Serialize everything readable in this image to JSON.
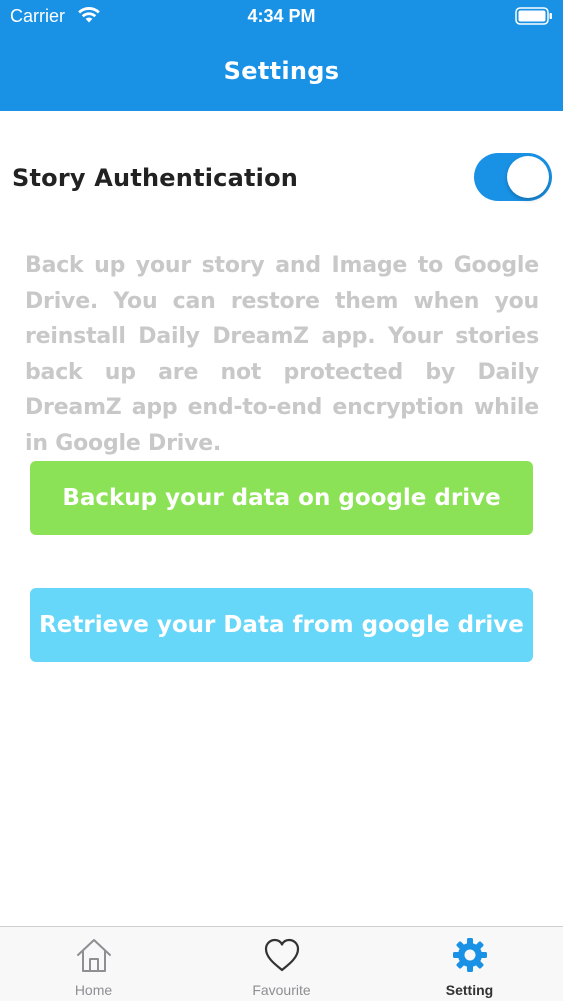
{
  "status_bar": {
    "carrier": "Carrier",
    "time": "4:34 PM"
  },
  "header": {
    "title": "Settings"
  },
  "settings": {
    "story_authentication_label": "Story Authentication",
    "story_authentication_enabled": true,
    "description": "Back up your story and Image to Google Drive. You can restore them when you reinstall Daily DreamZ app. Your stories back up are not protected by Daily DreamZ app end-to-end encryption while in Google Drive.",
    "backup_button_label": "Backup your data on google drive",
    "retrieve_button_label": "Retrieve your Data from google drive"
  },
  "tabbar": {
    "items": [
      {
        "label": "Home",
        "icon": "home-icon"
      },
      {
        "label": "Favourite",
        "icon": "heart-icon"
      },
      {
        "label": "Setting",
        "icon": "gear-icon"
      }
    ],
    "active_index": 2
  },
  "colors": {
    "primary": "#1992e6",
    "backup_button": "#8ce256",
    "retrieve_button": "#66d7f8",
    "description_text": "#c8c8c8"
  }
}
